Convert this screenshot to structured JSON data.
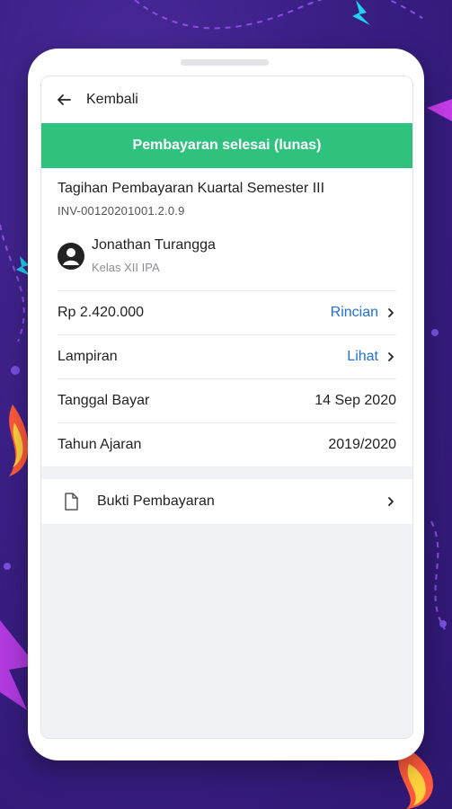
{
  "appbar": {
    "back_label": "Kembali"
  },
  "status_banner": {
    "text": "Pembayaran selesai (lunas)",
    "color": "#2ec27e"
  },
  "invoice": {
    "title": "Tagihan Pembayaran Kuartal Semester III",
    "number": "INV-00120201001.2.0.9"
  },
  "student": {
    "name": "Jonathan Turangga",
    "class": "Kelas XII IPA"
  },
  "details": {
    "amount": "Rp 2.420.000",
    "amount_action": "Rincian",
    "attachment_label": "Lampiran",
    "attachment_action": "Lihat",
    "payment_date_label": "Tanggal Bayar",
    "payment_date": "14 Sep 2020",
    "academic_year_label": "Tahun Ajaran",
    "academic_year": "2019/2020"
  },
  "proof": {
    "label": "Bukti Pembayaran"
  },
  "colors": {
    "link": "#1f6fd6",
    "background": "#3a1f86"
  }
}
